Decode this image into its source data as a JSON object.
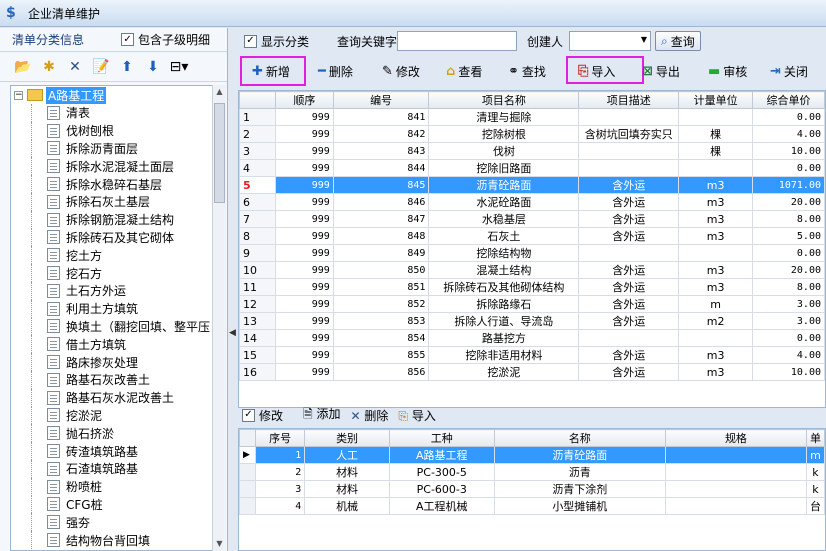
{
  "window": {
    "title": "企业清单维护"
  },
  "left": {
    "title": "清单分类信息",
    "include_children_label": "包含子级明细",
    "include_children_checked": true,
    "toolbar_icons": [
      "add-folder-icon",
      "add-item-icon",
      "delete-icon",
      "edit-icon",
      "move-up-icon",
      "move-down-icon",
      "layout-icon"
    ],
    "tree": {
      "root": "A路基工程",
      "items": [
        "清表",
        "伐树刨根",
        "拆除沥青面层",
        "拆除水泥混凝土面层",
        "拆除水稳碎石基层",
        "拆除石灰土基层",
        "拆除钢筋混凝土结构",
        "拆除砖石及其它砌体",
        "挖土方",
        "挖石方",
        "土石方外运",
        "利用土方填筑",
        "换填土（翻挖回填、整平压",
        "借土方填筑",
        "路床掺灰处理",
        "路基石灰改善土",
        "路基石灰水泥改善土",
        "挖淤泥",
        "抛石挤淤",
        "砖渣填筑路基",
        "石渣填筑路基",
        "粉喷桩",
        "CFG桩",
        "强夯",
        "结构物台背回填"
      ]
    }
  },
  "filter": {
    "show_category_label": "显示分类",
    "show_category_checked": true,
    "keyword_label": "查询关键字",
    "keyword_value": "",
    "creator_label": "创建人",
    "creator_value": "",
    "query_button": "查询"
  },
  "toolbar": {
    "new": "新增",
    "delete": "删除",
    "edit": "修改",
    "view": "查看",
    "find": "查找",
    "import": "导入",
    "export": "导出",
    "audit": "审核",
    "close": "关闭"
  },
  "grid": {
    "columns": [
      "顺序",
      "编号",
      "项目名称",
      "项目描述",
      "计量单位",
      "综合单价"
    ],
    "rows": [
      {
        "rn": "1",
        "seq": "999",
        "code": "841",
        "name": "清理与掘除",
        "desc": "",
        "unit": "",
        "price": "0.00"
      },
      {
        "rn": "2",
        "seq": "999",
        "code": "842",
        "name": "挖除树根",
        "desc": "含树坑回填夯实只",
        "unit": "棵",
        "price": "4.00"
      },
      {
        "rn": "3",
        "seq": "999",
        "code": "843",
        "name": "伐树",
        "desc": "",
        "unit": "棵",
        "price": "10.00"
      },
      {
        "rn": "4",
        "seq": "999",
        "code": "844",
        "name": "挖除旧路面",
        "desc": "",
        "unit": "",
        "price": "0.00"
      },
      {
        "rn": "5",
        "seq": "999",
        "code": "845",
        "name": "沥青砼路面",
        "desc": "含外运",
        "unit": "m3",
        "price": "1071.00"
      },
      {
        "rn": "6",
        "seq": "999",
        "code": "846",
        "name": "水泥砼路面",
        "desc": "含外运",
        "unit": "m3",
        "price": "20.00"
      },
      {
        "rn": "7",
        "seq": "999",
        "code": "847",
        "name": "水稳基层",
        "desc": "含外运",
        "unit": "m3",
        "price": "8.00"
      },
      {
        "rn": "8",
        "seq": "999",
        "code": "848",
        "name": "石灰土",
        "desc": "含外运",
        "unit": "m3",
        "price": "5.00"
      },
      {
        "rn": "9",
        "seq": "999",
        "code": "849",
        "name": "挖除结构物",
        "desc": "",
        "unit": "",
        "price": "0.00"
      },
      {
        "rn": "10",
        "seq": "999",
        "code": "850",
        "name": "混凝土结构",
        "desc": "含外运",
        "unit": "m3",
        "price": "20.00"
      },
      {
        "rn": "11",
        "seq": "999",
        "code": "851",
        "name": "拆除砖石及其他砌体结构",
        "desc": "含外运",
        "unit": "m3",
        "price": "8.00"
      },
      {
        "rn": "12",
        "seq": "999",
        "code": "852",
        "name": "拆除路缘石",
        "desc": "含外运",
        "unit": "m",
        "price": "3.00"
      },
      {
        "rn": "13",
        "seq": "999",
        "code": "853",
        "name": "拆除人行道、导流岛",
        "desc": "含外运",
        "unit": "m2",
        "price": "3.00"
      },
      {
        "rn": "14",
        "seq": "999",
        "code": "854",
        "name": "路基挖方",
        "desc": "",
        "unit": "",
        "price": "0.00"
      },
      {
        "rn": "15",
        "seq": "999",
        "code": "855",
        "name": "挖除非适用材料",
        "desc": "含外运",
        "unit": "m3",
        "price": "4.00"
      },
      {
        "rn": "16",
        "seq": "999",
        "code": "856",
        "name": "挖淤泥",
        "desc": "含外运",
        "unit": "m3",
        "price": "10.00"
      }
    ],
    "selected_row": 5
  },
  "subtoolbar": {
    "edit": "修改",
    "edit_checked": true,
    "add": "添加",
    "delete": "删除",
    "import": "导入"
  },
  "subgrid": {
    "columns": [
      "序号",
      "类别",
      "工种",
      "名称",
      "规格",
      "单"
    ],
    "rows": [
      {
        "no": "1",
        "type": "人工",
        "work": "A路基工程",
        "name": "沥青砼路面",
        "spec": "",
        "unit": "m"
      },
      {
        "no": "2",
        "type": "材料",
        "work": "PC-300-5",
        "name": "沥青",
        "spec": "",
        "unit": "k"
      },
      {
        "no": "3",
        "type": "材料",
        "work": "PC-600-3",
        "name": "沥青下涂剂",
        "spec": "",
        "unit": "k"
      },
      {
        "no": "4",
        "type": "机械",
        "work": "A工程机械",
        "name": "小型摊铺机",
        "spec": "",
        "unit": "台"
      }
    ]
  }
}
